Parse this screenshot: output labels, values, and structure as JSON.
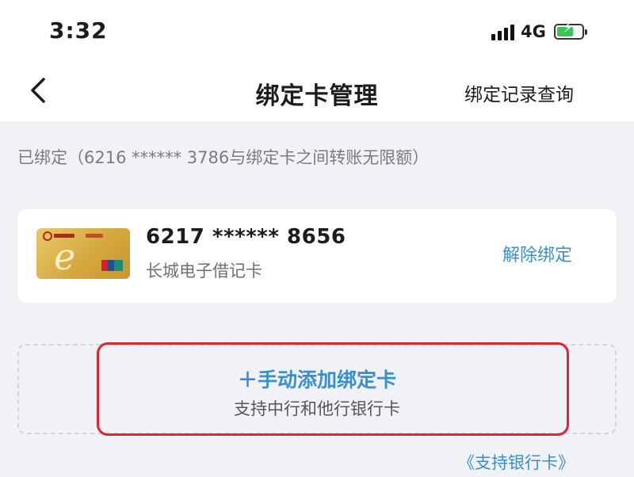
{
  "status_bar": {
    "time": "3:32",
    "network": "4G",
    "battery_color": "#35c759"
  },
  "header": {
    "back_icon": "chevron-left-icon",
    "title": "绑定卡管理",
    "record_link": "绑定记录查询"
  },
  "bound_note": "已绑定（6216 ****** 3786与绑定卡之间转账无限额）",
  "bound_card": {
    "number": "6217 ****** 8656",
    "name": "长城电子借记卡",
    "unbind_label": "解除绑定"
  },
  "add_card": {
    "label": "＋手动添加绑定卡",
    "sublabel": "支持中行和他行银行卡"
  },
  "supported_banks_link": "《支持银行卡》",
  "colors": {
    "accent": "#3a8fcf",
    "highlight": "#e0262e"
  }
}
